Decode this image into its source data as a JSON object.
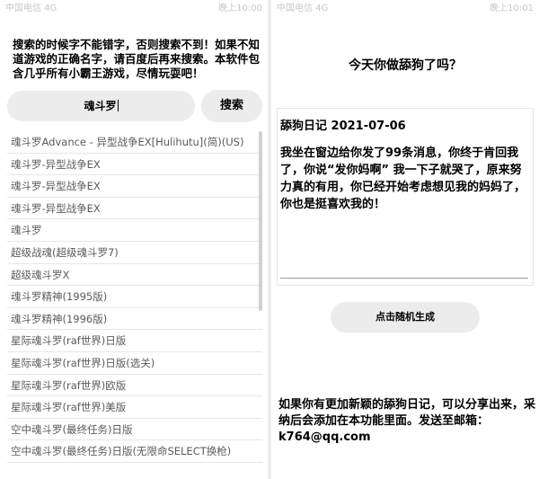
{
  "status_left": {
    "carrier": "中国电信",
    "time": "晚上10:00",
    "signal": "4G"
  },
  "status_right": {
    "carrier": "中国电信",
    "time": "晚上10:01",
    "signal": "4G"
  },
  "left": {
    "notice": "搜索的时候字不能错字，否则搜索不到！如果不知道游戏的正确名字，请百度后再来搜索。本软件包含几乎所有小霸王游戏，尽情玩耍吧！",
    "search_value": "魂斗罗",
    "search_button": "搜索",
    "results": [
      "魂斗罗Advance - 异型战争EX[Hulihutu](简)(US)",
      "魂斗罗-异型战争EX",
      "魂斗罗-异型战争EX",
      "魂斗罗-异型战争EX",
      "魂斗罗",
      "超级战魂(超级魂斗罗7)",
      "超级魂斗罗X",
      "魂斗罗精神(1995版)",
      "魂斗罗精神(1996版)",
      "星际魂斗罗(raf世界)日版",
      "星际魂斗罗(raf世界)日版(选关)",
      "星际魂斗罗(raf世界)欧版",
      "星际魂斗罗(raf世界)美版",
      "空中魂斗罗(最终任务)日版",
      "空中魂斗罗(最终任务)日版(无限命SELECT换枪)"
    ]
  },
  "right": {
    "question": "今天你做舔狗了吗？",
    "diary_title": "舔狗日记 2021-07-06",
    "diary_body": "我坐在窗边给你发了99条消息，你终于肯回我了，你说“发你妈啊” 我一下子就哭了，原来努力真的有用，你已经开始考虑想见我的妈妈了，你也是挺喜欢我的！",
    "generate_button": "点击随机生成",
    "footer": "如果你有更加新颖的舔狗日记，可以分享出来，采纳后会添加在本功能里面。发送至邮箱：k764@qq.com"
  }
}
